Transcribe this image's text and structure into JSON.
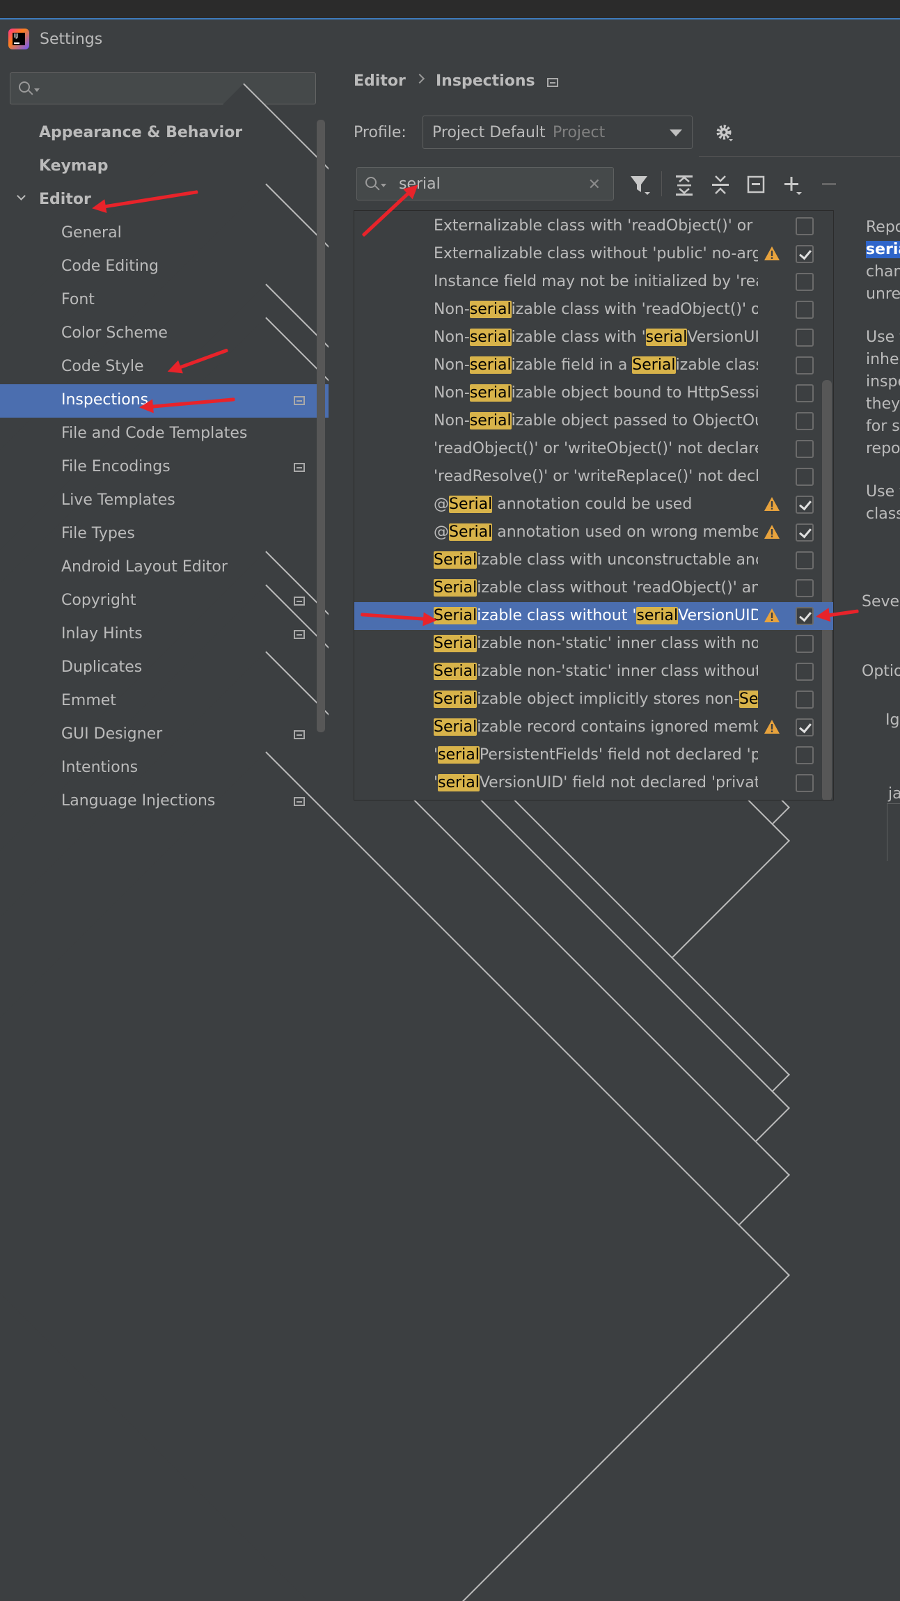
{
  "window": {
    "title": "Settings"
  },
  "sidebar": {
    "search_placeholder": "",
    "items": [
      {
        "label": "Appearance & Behavior",
        "chevron": "right",
        "bold": true,
        "project_icon": false
      },
      {
        "label": "Keymap",
        "chevron": "none",
        "bold": true,
        "project_icon": false
      },
      {
        "label": "Editor",
        "chevron": "down",
        "bold": true,
        "project_icon": false
      },
      {
        "label": "General",
        "chevron": "right",
        "bold": false,
        "project_icon": false
      },
      {
        "label": "Code Editing",
        "chevron": "none",
        "bold": false,
        "project_icon": false
      },
      {
        "label": "Font",
        "chevron": "none",
        "bold": false,
        "project_icon": false
      },
      {
        "label": "Color Scheme",
        "chevron": "right",
        "bold": false,
        "project_icon": false
      },
      {
        "label": "Code Style",
        "chevron": "right",
        "bold": false,
        "project_icon": false
      },
      {
        "label": "Inspections",
        "chevron": "none",
        "bold": false,
        "project_icon": true,
        "selected": true
      },
      {
        "label": "File and Code Templates",
        "chevron": "none",
        "bold": false,
        "project_icon": false
      },
      {
        "label": "File Encodings",
        "chevron": "none",
        "bold": false,
        "project_icon": true
      },
      {
        "label": "Live Templates",
        "chevron": "none",
        "bold": false,
        "project_icon": false
      },
      {
        "label": "File Types",
        "chevron": "none",
        "bold": false,
        "project_icon": false
      },
      {
        "label": "Android Layout Editor",
        "chevron": "none",
        "bold": false,
        "project_icon": false
      },
      {
        "label": "Copyright",
        "chevron": "right",
        "bold": false,
        "project_icon": true
      },
      {
        "label": "Inlay Hints",
        "chevron": "right",
        "bold": false,
        "project_icon": true
      },
      {
        "label": "Duplicates",
        "chevron": "none",
        "bold": false,
        "project_icon": false
      },
      {
        "label": "Emmet",
        "chevron": "right",
        "bold": false,
        "project_icon": false
      },
      {
        "label": "GUI Designer",
        "chevron": "none",
        "bold": false,
        "project_icon": true
      },
      {
        "label": "Intentions",
        "chevron": "none",
        "bold": false,
        "project_icon": false
      },
      {
        "label": "Language Injections",
        "chevron": "right",
        "bold": false,
        "project_icon": true
      }
    ]
  },
  "breadcrumb": {
    "parent": "Editor",
    "current": "Inspections"
  },
  "profile": {
    "label": "Profile:",
    "value": "Project Default",
    "scope": "Project"
  },
  "filter": {
    "search_value": "serial",
    "highlight_term": "serial"
  },
  "inspections": [
    {
      "text": "Externalizable class with 'readObject()' or 'writeObject()'",
      "warning": false,
      "checked": false
    },
    {
      "text": "Externalizable class without 'public' no-arg constructor",
      "warning": true,
      "checked": true
    },
    {
      "text": "Instance field may not be initialized by 'readObject()'",
      "warning": false,
      "checked": false
    },
    {
      "text": "Non-serializable class with 'readObject()' or 'writeObject()'",
      "warning": false,
      "checked": false
    },
    {
      "text": "Non-serializable class with 'serialVersionUID'",
      "warning": false,
      "checked": false
    },
    {
      "text": "Non-serializable field in a Serializable class",
      "warning": false,
      "checked": false
    },
    {
      "text": "Non-serializable object bound to HttpSession",
      "warning": false,
      "checked": false
    },
    {
      "text": "Non-serializable object passed to ObjectOutputStream",
      "warning": false,
      "checked": false
    },
    {
      "text": "'readObject()' or 'writeObject()' not declared 'private'",
      "warning": false,
      "checked": false
    },
    {
      "text": "'readResolve()' or 'writeReplace()' not declared 'protected'",
      "warning": false,
      "checked": false
    },
    {
      "text": "@Serial annotation could be used",
      "warning": true,
      "checked": true
    },
    {
      "text": "@Serial annotation used on wrong member",
      "warning": true,
      "checked": true
    },
    {
      "text": "Serializable class with unconstructable ancestor",
      "warning": false,
      "checked": false
    },
    {
      "text": "Serializable class without 'readObject()' and 'writeObject()'",
      "warning": false,
      "checked": false
    },
    {
      "text": "Serializable class without 'serialVersionUID'",
      "warning": true,
      "checked": true,
      "selected": true
    },
    {
      "text": "Serializable non-'static' inner class with non-Serializable outer class",
      "warning": false,
      "checked": false
    },
    {
      "text": "Serializable non-'static' inner class without 'serialVersionUID'",
      "warning": false,
      "checked": false
    },
    {
      "text": "Serializable object implicitly stores non-Serializable object",
      "warning": false,
      "checked": false
    },
    {
      "text": "Serializable record contains ignored members",
      "warning": true,
      "checked": true
    },
    {
      "text": "'serialPersistentFields' field not declared 'private static final ObjectStreamField[]'",
      "warning": false,
      "checked": false
    },
    {
      "text": "'serialVersionUID' field not declared 'private static final long'",
      "warning": false,
      "checked": false
    }
  ],
  "description": {
    "lines": [
      "Repo",
      "seria",
      "chan",
      "unre",
      "",
      "Use t",
      "inhe",
      "inspe",
      "they",
      "for s",
      "repo",
      "",
      "Use t",
      "class"
    ],
    "severity_label": "Sever",
    "options_label": "Optio",
    "ignore_label": "Ig",
    "bottom_text": "ja"
  },
  "colors": {
    "accent": "#4b6eaf",
    "highlight": "#d8b34a",
    "annotation": "#e8232a"
  }
}
